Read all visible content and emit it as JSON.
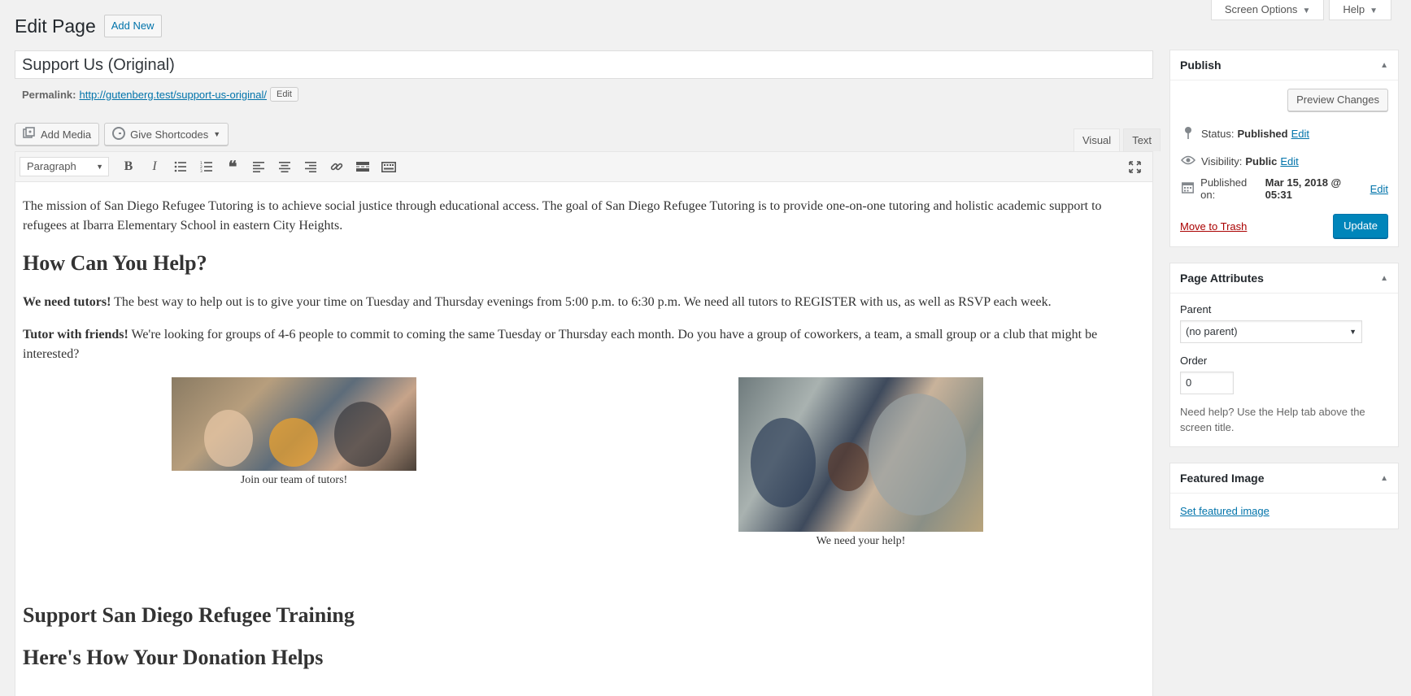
{
  "screen_meta": {
    "screen_options_label": "Screen Options",
    "help_label": "Help"
  },
  "header": {
    "title": "Edit Page",
    "add_new_label": "Add New"
  },
  "post": {
    "title": "Support Us (Original)",
    "permalink_label": "Permalink:",
    "permalink_url": "http://gutenberg.test/support-us-original/",
    "permalink_edit_label": "Edit"
  },
  "media_buttons": {
    "add_media_label": "Add Media",
    "shortcodes_label": "Give Shortcodes"
  },
  "editor_tabs": {
    "visual": "Visual",
    "text": "Text"
  },
  "toolbar": {
    "format_value": "Paragraph",
    "buttons": [
      "bold",
      "italic",
      "bullet-list",
      "numbered-list",
      "blockquote",
      "align-left",
      "align-center",
      "align-right",
      "insert-link",
      "read-more",
      "toolbar-toggle",
      "fullscreen"
    ]
  },
  "content": {
    "intro": "The mission of San Diego Refugee Tutoring is to achieve social justice through educational access. The goal of San Diego Refugee Tutoring is to provide one-on-one tutoring and holistic academic support to refugees at Ibarra Elementary School in eastern City Heights.",
    "heading_help": "How Can You Help?",
    "tutors_bold": "We need tutors!",
    "tutors_text": " The best way to help out is to give your time on Tuesday and Thursday evenings from 5:00 p.m. to 6:30 p.m. We need all tutors to REGISTER with us, as well as RSVP each week.",
    "friends_bold": "Tutor with friends!",
    "friends_text": " We're looking for groups of 4-6 people to commit to coming the same Tuesday or Thursday each month. Do you have a group of coworkers, a team, a small group or a club that might be interested?",
    "caption_1": "Join our team of tutors!",
    "caption_2": "We need your help!",
    "heading_support": "Support San Diego Refugee Training",
    "heading_donation": "Here's How Your Donation Helps"
  },
  "publish": {
    "title": "Publish",
    "preview_label": "Preview Changes",
    "status_label": "Status:",
    "status_value": "Published",
    "status_edit": "Edit",
    "visibility_label": "Visibility:",
    "visibility_value": "Public",
    "visibility_edit": "Edit",
    "published_label": "Published on:",
    "published_value": "Mar 15, 2018 @ 05:31",
    "published_edit": "Edit",
    "trash_label": "Move to Trash",
    "update_label": "Update"
  },
  "page_attributes": {
    "title": "Page Attributes",
    "parent_label": "Parent",
    "parent_value": "(no parent)",
    "order_label": "Order",
    "order_value": "0",
    "help_text": "Need help? Use the Help tab above the screen title."
  },
  "featured_image": {
    "title": "Featured Image",
    "set_label": "Set featured image"
  },
  "colors": {
    "primary_button": "#0085ba",
    "link": "#0073aa",
    "trash": "#a00000"
  }
}
